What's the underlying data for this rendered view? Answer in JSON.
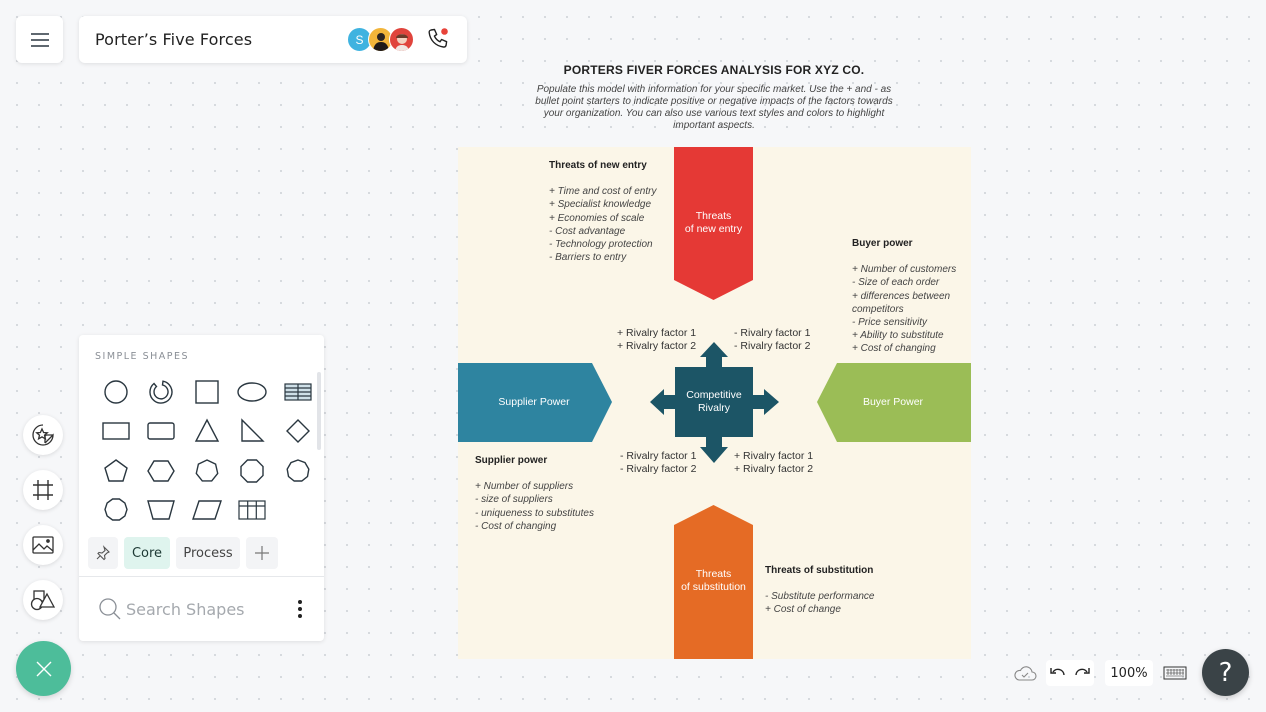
{
  "app": {
    "document_title": "Porter’s Five Forces",
    "collaborators": [
      {
        "initial": "S",
        "color": "#3fb3e0"
      },
      {
        "initial": "",
        "color": "#f2b53a"
      },
      {
        "initial": "",
        "color": "#e0443c"
      }
    ],
    "call_status_color": "#e8433a"
  },
  "canvas": {
    "heading": "PORTERS FIVER FORCES ANALYSIS FOR XYZ CO.",
    "description": "Populate this model with information for your specific market. Use the + and - as bullet point starters to indicate positive or negative impacts of the factors towards your organization.  You can also use various text styles and colors to highlight important aspects.",
    "background_color": "#fbf6e8",
    "forces": {
      "new_entry": {
        "label_line1": "Threats",
        "label_line2": "of new entry",
        "color": "#e53935"
      },
      "supplier": {
        "label": "Supplier Power",
        "color": "#2e84a0"
      },
      "buyer": {
        "label": "Buyer Power",
        "color": "#9bbd56"
      },
      "substitution": {
        "label_line1": "Threats",
        "label_line2": "of substitution",
        "color": "#e56b25"
      },
      "rivalry": {
        "label_line1": "Competitive",
        "label_line2": "Rivalry",
        "color": "#1c5566"
      }
    },
    "notes": {
      "new_entry": {
        "heading": "Threats of new entry",
        "items": [
          "+ Time and cost of entry",
          "+ Specialist knowledge",
          "+ Economies of scale",
          "- Cost advantage",
          "- Technology protection",
          "- Barriers to entry"
        ]
      },
      "buyer": {
        "heading": "Buyer power",
        "items": [
          "+ Number of customers",
          "- Size of each order",
          "+ differences between",
          "competitors",
          "- Price sensitivity",
          "+ Ability to substitute",
          "+ Cost of changing"
        ]
      },
      "supplier": {
        "heading": "Supplier power",
        "items": [
          "+ Number of suppliers",
          "- size of suppliers",
          "- uniqueness to substitutes",
          "- Cost of changing"
        ]
      },
      "substitution": {
        "heading": "Threats of substitution",
        "items": [
          "- Substitute performance",
          "+ Cost of change"
        ]
      }
    },
    "rivalry_factors": {
      "top_left": [
        "+ Rivalry factor 1",
        "+ Rivalry factor 2"
      ],
      "top_right": [
        "- Rivalry factor 1",
        "- Rivalry factor 2"
      ],
      "bottom_left": [
        "- Rivalry factor 1",
        "- Rivalry factor 2"
      ],
      "bottom_right": [
        "+ Rivalry factor 1",
        "+ Rivalry factor 2"
      ]
    }
  },
  "shapes_panel": {
    "section_title": "SIMPLE SHAPES",
    "shapes": [
      "circle",
      "arc-ring",
      "square",
      "ellipse",
      "table-striped",
      "rectangle",
      "rounded-rectangle",
      "triangle",
      "right-triangle",
      "diamond",
      "pentagon",
      "hexagon",
      "heptagon",
      "octagon",
      "nonagon",
      "decagon",
      "trapezoid",
      "parallelogram",
      "grid-table"
    ],
    "tabs": [
      {
        "label": "",
        "icon": "pin-icon",
        "active": false
      },
      {
        "label": "Core",
        "active": true
      },
      {
        "label": "Process",
        "active": false
      },
      {
        "label": "",
        "icon": "plus-icon",
        "active": false
      }
    ],
    "search_placeholder": "Search Shapes"
  },
  "bottom_bar": {
    "zoom_level": "100%",
    "help_label": "?"
  },
  "accent_color": "#4dbd9a"
}
